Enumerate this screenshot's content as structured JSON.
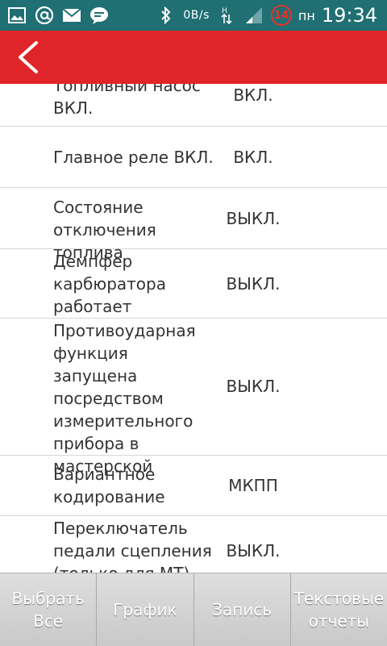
{
  "status_bar": {
    "network_speed": "0B/s",
    "day": "пн",
    "time": "19:34",
    "badge": "14",
    "icons": [
      "image-icon",
      "at-icon",
      "mail-icon",
      "message-icon",
      "bluetooth-icon",
      "data-arrows-icon",
      "signal-icon",
      "alarm-badge-icon"
    ]
  },
  "app_bar": {
    "back_icon": "chevron-left-icon",
    "color": "#e0252a"
  },
  "rows": [
    {
      "name": "Топливный насос ВКЛ.",
      "value": "ВКЛ."
    },
    {
      "name": "Главное реле ВКЛ.",
      "value": "ВКЛ."
    },
    {
      "name": "Состояние отключения топлива",
      "value": "ВЫКЛ."
    },
    {
      "name": "Демпфер карбюратора работает",
      "value": "ВЫКЛ."
    },
    {
      "name": "Противоударная функция запущена посредством измерительного прибора в мастерской",
      "value": "ВЫКЛ."
    },
    {
      "name": "Вариантное кодирование",
      "value": "МКПП"
    },
    {
      "name": "Переключатель педали сцепления (только для МТ)",
      "value": "ВЫКЛ."
    }
  ],
  "bottom_bar": {
    "select_all": "Выбрать Все",
    "graph": "График",
    "record": "Запись",
    "text_reports": "Текстовые отчеты"
  }
}
